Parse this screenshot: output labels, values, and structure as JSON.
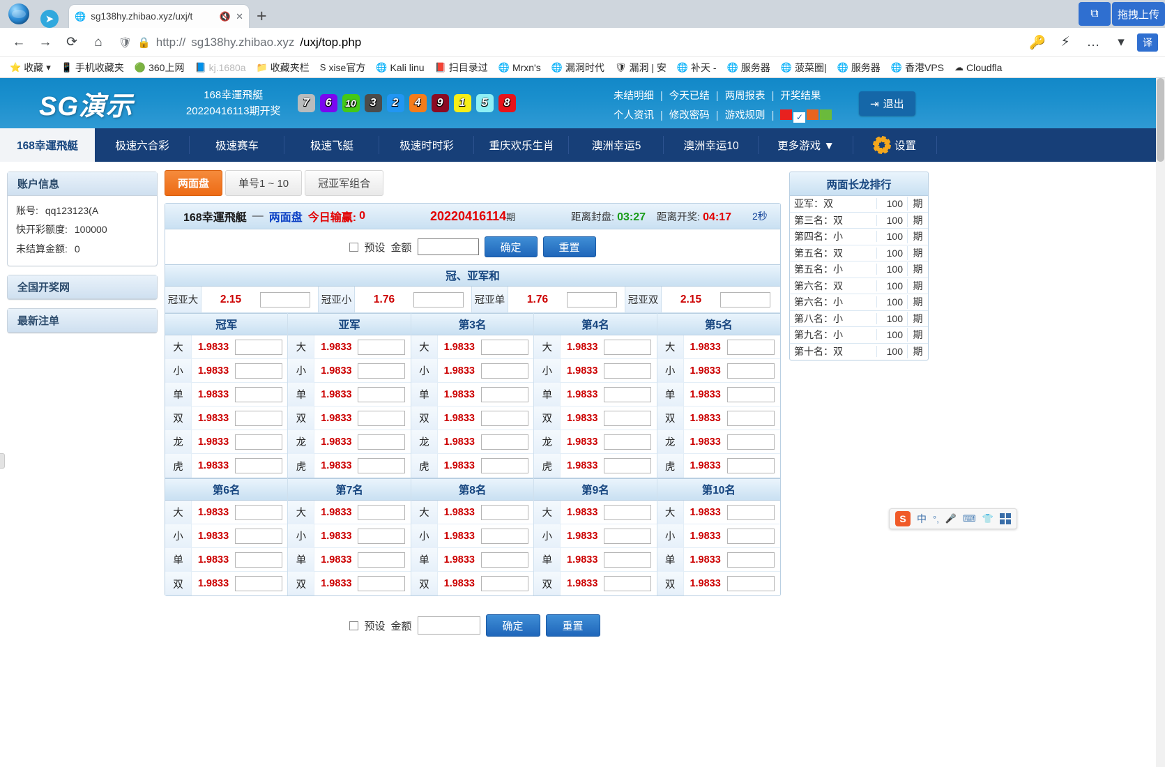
{
  "browser": {
    "tab": {
      "title": "sg138hy.zhibao.xyz/uxj/t",
      "mute_icon": "speaker-mute-icon",
      "close_icon": "close-icon",
      "globe_icon": "globe-icon"
    },
    "newtab_label": "+",
    "nav": {
      "back": "←",
      "forward": "→",
      "reload": "⟳",
      "home": "⌂"
    },
    "url": {
      "scheme_prefix": "http://",
      "host": "sg138hy.zhibao.xyz",
      "path": "/uxj/top.php",
      "shield_icon": "shield-icon",
      "lock_icon": "lock-icon"
    },
    "right_icons": {
      "key": "key-icon",
      "lightning": "lightning-icon",
      "more": "…",
      "chevron": "▾",
      "translate_label": "译"
    },
    "drag_pill_label": "拖拽上传",
    "bookmarks": [
      {
        "icon": "star-icon",
        "label": "收藏",
        "caret": "▾"
      },
      {
        "icon": "phone-icon",
        "label": "手机收藏夹"
      },
      {
        "icon": "360-icon",
        "label": "360上网"
      },
      {
        "icon": "page-icon",
        "label": "kj.1680a"
      },
      {
        "icon": "folder-icon",
        "label": "收藏夹栏"
      },
      {
        "icon": "s-icon",
        "label": "xise官方"
      },
      {
        "icon": "globe-icon",
        "label": "Kali linu"
      },
      {
        "icon": "book-icon",
        "label": "扫目录过"
      },
      {
        "icon": "globe-icon",
        "label": "Mrxn's"
      },
      {
        "icon": "globe-icon",
        "label": "漏洞时代"
      },
      {
        "icon": "shield-icon",
        "label": "漏洞 | 安"
      },
      {
        "icon": "globe-icon",
        "label": "补天 -"
      },
      {
        "icon": "globe-icon",
        "label": "服务器"
      },
      {
        "icon": "globe-icon",
        "label": "菠菜圈|"
      },
      {
        "icon": "globe-icon",
        "label": "服务器"
      },
      {
        "icon": "globe-icon",
        "label": "香港VPS"
      },
      {
        "icon": "cloud-icon",
        "label": "Cloudfla"
      }
    ]
  },
  "header": {
    "logo": "SG演示",
    "draw_line1": "168幸運飛艇",
    "draw_line2": "20220416113期开奖",
    "balls": [
      {
        "n": "7",
        "bg": "#b9bcbd"
      },
      {
        "n": "6",
        "bg": "#7a07f0"
      },
      {
        "n": "10",
        "bg": "#44c916"
      },
      {
        "n": "3",
        "bg": "#4b4b4b"
      },
      {
        "n": "2",
        "bg": "#2196f3"
      },
      {
        "n": "4",
        "bg": "#f57c1a"
      },
      {
        "n": "9",
        "bg": "#8c0a22"
      },
      {
        "n": "1",
        "bg": "#f7ee16"
      },
      {
        "n": "5",
        "bg": "#8ef0f5"
      },
      {
        "n": "8",
        "bg": "#e8131a"
      }
    ],
    "links_row1": [
      "未结明细",
      "今天已结",
      "两周报表",
      "开奖结果"
    ],
    "links_row2": [
      "个人资讯",
      "修改密码",
      "游戏规则"
    ],
    "swatches": [
      "#e8211f",
      "#ffffff",
      "#e8641f",
      "#6aba3c"
    ],
    "swatch_check": "✓",
    "logout_label": "退出",
    "logout_icon": "logout-icon"
  },
  "nav": {
    "items": [
      "168幸運飛艇",
      "极速六合彩",
      "极速赛车",
      "极速飞艇",
      "极速时时彩",
      "重庆欢乐生肖",
      "澳洲幸运5",
      "澳洲幸运10",
      "更多游戏 ▼"
    ],
    "active_index": 0,
    "settings_label": "设置",
    "settings_icon": "gear-icon"
  },
  "sidebar_left": {
    "account_panel": {
      "title": "账户信息",
      "rows": [
        {
          "key": "账号:",
          "value": "qq123123(A"
        },
        {
          "key": "快开彩额度:",
          "value": "100000"
        },
        {
          "key": "未结算金额:",
          "value": "0"
        }
      ]
    },
    "links": [
      "全国开奖网",
      "最新注单"
    ]
  },
  "main": {
    "subtabs": [
      "两面盘",
      "单号1 ~ 10",
      "冠亚军组合"
    ],
    "subtabs_active": 0,
    "board_head": {
      "game": "168幸運飛艇",
      "dash": "—",
      "mode": "两面盘",
      "pnl_label": "今日输赢:",
      "pnl_value": "0",
      "issue": "20220416114",
      "issue_suffix": "期",
      "close_label": "距离封盘:",
      "close_time": "03:27",
      "draw_label": "距离开奖:",
      "draw_time": "04:17",
      "seconds": "2秒"
    },
    "preset": {
      "checkbox_label": "预设",
      "amount_label": "金额",
      "amount_value": "",
      "confirm_label": "确定",
      "reset_label": "重置"
    },
    "sum_section": {
      "title": "冠、亚军和",
      "items": [
        {
          "label": "冠亚大",
          "odds": "2.15",
          "value": ""
        },
        {
          "label": "冠亚小",
          "odds": "1.76",
          "value": ""
        },
        {
          "label": "冠亚单",
          "odds": "1.76",
          "value": ""
        },
        {
          "label": "冠亚双",
          "odds": "2.15",
          "value": ""
        }
      ]
    },
    "grid_top": {
      "columns": [
        "冠军",
        "亚军",
        "第3名",
        "第4名",
        "第5名"
      ],
      "rows": [
        "大",
        "小",
        "单",
        "双",
        "龙",
        "虎"
      ],
      "odds": "1.9833"
    },
    "grid_bottom": {
      "columns": [
        "第6名",
        "第7名",
        "第8名",
        "第9名",
        "第10名"
      ],
      "rows": [
        "大",
        "小",
        "单",
        "双"
      ],
      "odds": "1.9833"
    },
    "bottom_preset": {
      "checkbox_label": "预设",
      "amount_label": "金额",
      "amount_value": "",
      "confirm_label": "确定",
      "reset_label": "重置"
    }
  },
  "sidebar_right": {
    "title": "两面长龙排行",
    "rows": [
      {
        "name": "亚军：双",
        "count": "100",
        "unit": "期"
      },
      {
        "name": "第三名：双",
        "count": "100",
        "unit": "期"
      },
      {
        "name": "第四名：小",
        "count": "100",
        "unit": "期"
      },
      {
        "name": "第五名：双",
        "count": "100",
        "unit": "期"
      },
      {
        "name": "第五名：小",
        "count": "100",
        "unit": "期"
      },
      {
        "name": "第六名：双",
        "count": "100",
        "unit": "期"
      },
      {
        "name": "第六名：小",
        "count": "100",
        "unit": "期"
      },
      {
        "name": "第八名：小",
        "count": "100",
        "unit": "期"
      },
      {
        "name": "第九名：小",
        "count": "100",
        "unit": "期"
      },
      {
        "name": "第十名：双",
        "count": "100",
        "unit": "期"
      }
    ]
  },
  "ime": {
    "logo": "S",
    "mode": "中",
    "punct": "°,",
    "mic_icon": "microphone-icon",
    "keyboard_icon": "keyboard-icon",
    "skin_icon": "shirt-icon",
    "apps_icon": "apps-icon"
  }
}
